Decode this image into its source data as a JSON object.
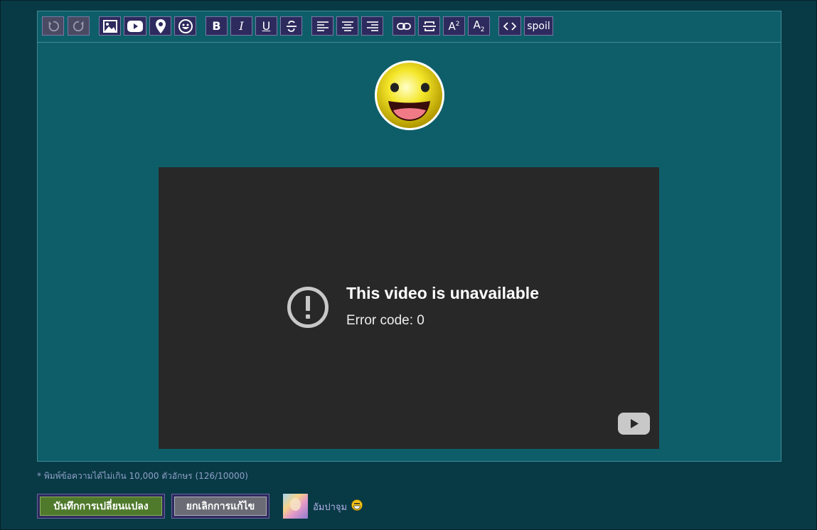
{
  "toolbar": {
    "buttons": [
      {
        "name": "undo-button",
        "icon": "undo-icon"
      },
      {
        "name": "redo-button",
        "icon": "redo-icon"
      },
      {
        "name": "insert-image-button",
        "icon": "image-icon"
      },
      {
        "name": "insert-youtube-button",
        "icon": "youtube-icon"
      },
      {
        "name": "insert-location-button",
        "icon": "map-pin-icon"
      },
      {
        "name": "insert-emoji-button",
        "icon": "smiley-icon"
      },
      {
        "name": "bold-button",
        "icon": "bold-icon",
        "label": "B"
      },
      {
        "name": "italic-button",
        "icon": "italic-icon",
        "label": "I"
      },
      {
        "name": "underline-button",
        "icon": "underline-icon",
        "label": "U"
      },
      {
        "name": "strikethrough-button",
        "icon": "strikethrough-icon",
        "label": "S"
      },
      {
        "name": "align-left-button",
        "icon": "align-left-icon"
      },
      {
        "name": "align-center-button",
        "icon": "align-center-icon"
      },
      {
        "name": "align-right-button",
        "icon": "align-right-icon"
      },
      {
        "name": "link-button",
        "icon": "link-icon"
      },
      {
        "name": "horizontal-rule-button",
        "icon": "horizontal-rule-icon"
      },
      {
        "name": "superscript-button",
        "icon": "superscript-icon"
      },
      {
        "name": "subscript-button",
        "icon": "subscript-icon"
      },
      {
        "name": "code-button",
        "icon": "code-icon"
      },
      {
        "name": "spoiler-button",
        "label": "spoil"
      }
    ],
    "spoil_label": "spoil",
    "bold_label": "B",
    "italic_label": "I",
    "underline_label": "U",
    "sup_label": "A",
    "sup_exp": "2",
    "sub_label": "A",
    "sub_exp": "2"
  },
  "content": {
    "emoji": "smiley-face-icon",
    "video": {
      "title": "This video is unavailable",
      "error": "Error code: 0",
      "icon": "warning-circle-icon",
      "logo": "youtube-logo-icon"
    }
  },
  "char_limit_note": "* พิมพ์ข้อความได้ไม่เกิน 10,000 ตัวอักษร (126/10000)",
  "actions": {
    "save_label": "บันทึกการเปลี่ยนแปลง",
    "cancel_label": "ยกเลิกการแก้ไข"
  },
  "user": {
    "name": "อัมปาจุม",
    "status_icon": "grin-emoji-icon"
  },
  "colors": {
    "page_bg": "#083a45",
    "editor_bg": "#0e5e6a",
    "button_bg": "#2d2a5e",
    "save_bg": "#4f7a2c",
    "cancel_bg": "#6b6b75",
    "video_bg": "#282828"
  }
}
